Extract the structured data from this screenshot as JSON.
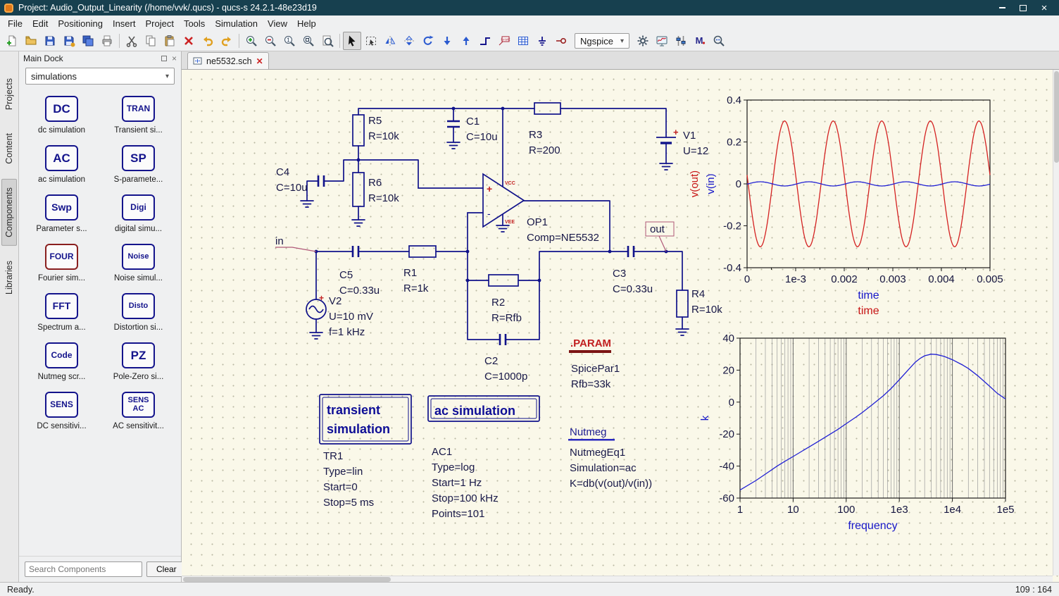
{
  "window": {
    "title": "Project: Audio_Output_Linearity (/home/vvk/.qucs) - qucs-s 24.2.1-48e23d19"
  },
  "menu": [
    "File",
    "Edit",
    "Positioning",
    "Insert",
    "Project",
    "Tools",
    "Simulation",
    "View",
    "Help"
  ],
  "toolbar": {
    "engine": "Ngspice"
  },
  "dock": {
    "title": "Main Dock",
    "selector_value": "simulations",
    "tabs": [
      {
        "label": "Projects",
        "selected": false
      },
      {
        "label": "Content",
        "selected": false
      },
      {
        "label": "Components",
        "selected": true
      },
      {
        "label": "Libraries",
        "selected": false
      }
    ],
    "components": [
      {
        "icon": "DC",
        "label": "dc simulation"
      },
      {
        "icon": "TRAN",
        "label": "Transient si..."
      },
      {
        "icon": "AC",
        "label": "ac simulation"
      },
      {
        "icon": "SP",
        "label": "S-paramete..."
      },
      {
        "icon": "Swp",
        "label": "Parameter s..."
      },
      {
        "icon": "Digi",
        "label": "digital simu..."
      },
      {
        "icon": "FOUR",
        "label": "Fourier sim...",
        "accent": "#8a1f1f"
      },
      {
        "icon": "Noise",
        "label": "Noise simul..."
      },
      {
        "icon": "FFT",
        "label": "Spectrum a..."
      },
      {
        "icon": "Disto",
        "label": "Distortion si..."
      },
      {
        "icon": "Code",
        "label": "Nutmeg scr..."
      },
      {
        "icon": "PZ",
        "label": "Pole-Zero si..."
      },
      {
        "icon": "SENS",
        "label": "DC sensitivi..."
      },
      {
        "icon": "SENS AC",
        "label": "AC sensitivit..."
      }
    ],
    "search_placeholder": "Search Components",
    "clear_label": "Clear"
  },
  "editor": {
    "tab_label": "ne5532.sch"
  },
  "schematic": {
    "r5": {
      "name": "R5",
      "value": "R=10k"
    },
    "c1": {
      "name": "C1",
      "value": "C=10u"
    },
    "r3": {
      "name": "R3",
      "value": "R=200"
    },
    "v1": {
      "name": "V1",
      "value": "U=12",
      "plus": "+"
    },
    "c4": {
      "name": "C4",
      "value": "C=10u"
    },
    "r6": {
      "name": "R6",
      "value": "R=10k"
    },
    "op1": {
      "name": "OP1",
      "value": "Comp=NE5532",
      "plus": "+",
      "minus": "-",
      "vcc": "VCC",
      "vee": "VEE"
    },
    "c5": {
      "name": "C5",
      "value": "C=0.33u"
    },
    "r1": {
      "name": "R1",
      "value": "R=1k"
    },
    "v2": {
      "name": "V2",
      "value": "U=10 mV",
      "value2": "f=1 kHz",
      "plus": "+"
    },
    "r2": {
      "name": "R2",
      "value": "R=Rfb"
    },
    "c2": {
      "name": "C2",
      "value": "C=1000p"
    },
    "c3": {
      "name": "C3",
      "value": "C=0.33u"
    },
    "r4": {
      "name": "R4",
      "value": "R=10k"
    },
    "in_label": "in",
    "out_label": "out",
    "blocks": {
      "transient": {
        "title1": "transient",
        "title2": "simulation",
        "lines": [
          "TR1",
          "Type=lin",
          "Start=0",
          "Stop=5 ms"
        ]
      },
      "ac": {
        "title": "ac simulation",
        "lines": [
          "AC1",
          "Type=log",
          "Start=1 Hz",
          "Stop=100 kHz",
          "Points=101"
        ]
      },
      "param": {
        "title": ".PARAM",
        "lines": [
          "SpicePar1",
          "Rfb=33k"
        ]
      },
      "nutmeg": {
        "title": "Nutmeg",
        "lines": [
          "NutmegEq1",
          "Simulation=ac",
          "K=db(v(out)/v(in))"
        ]
      }
    }
  },
  "chart_data": [
    {
      "type": "line",
      "xlim": [
        0,
        0.005
      ],
      "ylim": [
        -0.4,
        0.4
      ],
      "x_tick_labels": [
        "0",
        "1e-3",
        "0.002",
        "0.003",
        "0.004",
        "0.005"
      ],
      "y_tick_labels": [
        "0.4",
        "0.2",
        "0",
        "-0.2",
        "-0.4"
      ],
      "xlabels": [
        {
          "text": "time",
          "color": "#1616c8"
        },
        {
          "text": "time",
          "color": "#c81616"
        }
      ],
      "ylabels": [
        {
          "text": "v(out)",
          "color": "#c81616"
        },
        {
          "text": "v(in)",
          "color": "#1616c8"
        }
      ],
      "grid": false,
      "series": [
        {
          "name": "v(out)",
          "color": "#d42020",
          "waveform": "sine",
          "amplitude": 0.3,
          "frequency": 1000,
          "phase": 3.0
        },
        {
          "name": "v(in)",
          "color": "#2020d4",
          "waveform": "sine",
          "amplitude": 0.01,
          "frequency": 1000,
          "phase": 6.14
        }
      ]
    },
    {
      "type": "line",
      "x_scale": "log",
      "xlim": [
        1,
        100000
      ],
      "ylim": [
        -60,
        40
      ],
      "x_tick_labels": [
        "1",
        "10",
        "100",
        "1e3",
        "1e4",
        "1e5"
      ],
      "y_tick_labels": [
        "40",
        "20",
        "0",
        "-20",
        "-40",
        "-60"
      ],
      "xlabels": [
        {
          "text": "frequency",
          "color": "#1616c8"
        }
      ],
      "ylabels": [
        {
          "text": "k",
          "color": "#1616c8"
        }
      ],
      "grid": "log-x",
      "series": [
        {
          "name": "k",
          "color": "#2020d4",
          "points": [
            [
              1,
              -55
            ],
            [
              2,
              -49
            ],
            [
              3,
              -45
            ],
            [
              5,
              -40
            ],
            [
              7,
              -37
            ],
            [
              10,
              -34
            ],
            [
              15,
              -30.5
            ],
            [
              20,
              -28
            ],
            [
              30,
              -24.5
            ],
            [
              50,
              -20
            ],
            [
              70,
              -17
            ],
            [
              100,
              -13.5
            ],
            [
              150,
              -9.5
            ],
            [
              200,
              -6.5
            ],
            [
              300,
              -2
            ],
            [
              500,
              4
            ],
            [
              700,
              8.5
            ],
            [
              1000,
              14
            ],
            [
              1500,
              20.5
            ],
            [
              2000,
              25
            ],
            [
              2500,
              27.5
            ],
            [
              3000,
              29
            ],
            [
              4000,
              30
            ],
            [
              5000,
              29.8
            ],
            [
              7000,
              28.6
            ],
            [
              10000,
              26.5
            ],
            [
              15000,
              23.5
            ],
            [
              20000,
              21
            ],
            [
              30000,
              16.5
            ],
            [
              50000,
              10
            ],
            [
              70000,
              5.5
            ],
            [
              100000,
              2
            ]
          ]
        }
      ]
    }
  ],
  "status": {
    "message": "Ready.",
    "position": "109 : 164"
  }
}
